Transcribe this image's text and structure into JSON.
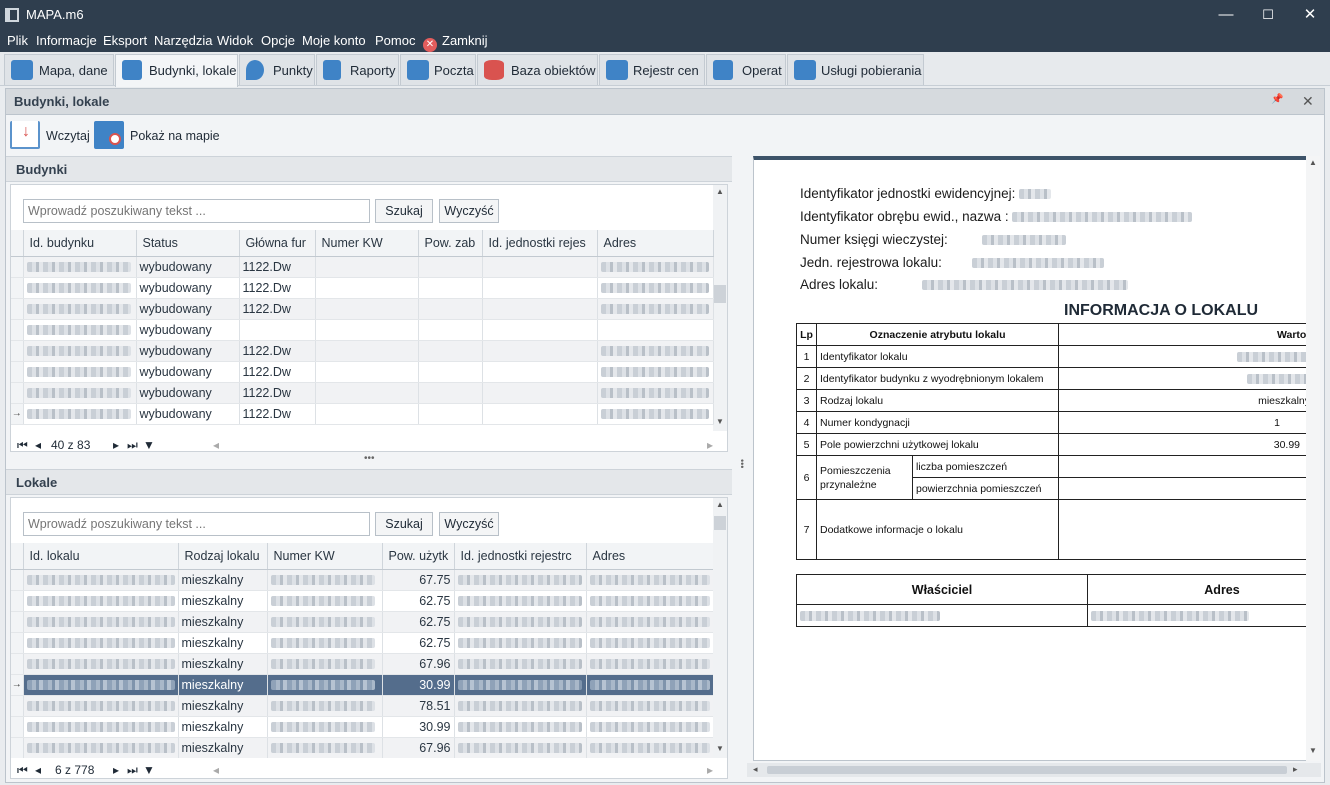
{
  "window": {
    "title": "MAPA.m6",
    "min": "—",
    "max": "☐",
    "close": "✕"
  },
  "menu": [
    "Plik",
    "Informacje",
    "Eksport",
    "Narzędzia",
    "Widok",
    "Opcje",
    "Moje konto",
    "Pomoc",
    "Zamknij"
  ],
  "tabs": [
    "Mapa, dane",
    "Budynki, lokale",
    "Punkty",
    "Raporty",
    "Poczta",
    "Baza obiektów",
    "Rejestr cen",
    "Operat",
    "Usługi pobierania"
  ],
  "active_tab": "Budynki, lokale",
  "panel": {
    "title": "Budynki, lokale",
    "pin": "📌",
    "close": "✕"
  },
  "toolbar": {
    "load": "Wczytaj",
    "show_map": "Pokaż na mapie"
  },
  "buildings": {
    "header": "Budynki",
    "search_placeholder": "Wprowadź poszukiwany tekst ...",
    "search_btn": "Szukaj",
    "clear_btn": "Wyczyść",
    "columns": [
      "Id. budynku",
      "Status",
      "Główna fur",
      "Numer KW",
      "Pow. zab",
      "Id. jednostki rejes",
      "Adres"
    ],
    "rows": [
      {
        "status": "wybudowany",
        "func": "1122.Dw"
      },
      {
        "status": "wybudowany",
        "func": "1122.Dw"
      },
      {
        "status": "wybudowany",
        "func": "1122.Dw"
      },
      {
        "status": "wybudowany",
        "func": ""
      },
      {
        "status": "wybudowany",
        "func": "1122.Dw"
      },
      {
        "status": "wybudowany",
        "func": "1122.Dw"
      },
      {
        "status": "wybudowany",
        "func": "1122.Dw"
      },
      {
        "status": "wybudowany",
        "func": "1122.Dw"
      }
    ],
    "pager": "40 z 83"
  },
  "locals": {
    "header": "Lokale",
    "search_placeholder": "Wprowadź poszukiwany tekst ...",
    "search_btn": "Szukaj",
    "clear_btn": "Wyczyść",
    "columns": [
      "Id. lokalu",
      "Rodzaj lokalu",
      "Numer KW",
      "Pow. użytk",
      "Id. jednostki rejestrc",
      "Adres"
    ],
    "rows": [
      {
        "type": "mieszkalny",
        "area": "67.75"
      },
      {
        "type": "mieszkalny",
        "area": "62.75"
      },
      {
        "type": "mieszkalny",
        "area": "62.75"
      },
      {
        "type": "mieszkalny",
        "area": "62.75"
      },
      {
        "type": "mieszkalny",
        "area": "67.96"
      },
      {
        "type": "mieszkalny",
        "area": "30.99"
      },
      {
        "type": "mieszkalny",
        "area": "78.51"
      },
      {
        "type": "mieszkalny",
        "area": "30.99"
      },
      {
        "type": "mieszkalny",
        "area": "67.96"
      }
    ],
    "pager": "6 z 778"
  },
  "report": {
    "labels": [
      "Identyfikator jednostki ewidencyjnej:",
      "Identyfikator obrębu ewid., nazwa :",
      "Numer księgi wieczystej:",
      "Jedn. rejestrowa lokalu:",
      "Adres lokalu:"
    ],
    "title": "INFORMACJA O LOKALU",
    "col_lp": "Lp",
    "col_attr": "Oznaczenie atrybutu lokalu",
    "col_value": "Wartość",
    "rows": {
      "r1": {
        "lp": "1",
        "attr": "Identyfikator lokalu"
      },
      "r2": {
        "lp": "2",
        "attr": "Identyfikator budynku z wyodrębnionym lokalem"
      },
      "r3": {
        "lp": "3",
        "attr": "Rodzaj lokalu",
        "val": "mieszkalny"
      },
      "r4": {
        "lp": "4",
        "attr": "Numer kondygnacji",
        "val": "1"
      },
      "r5": {
        "lp": "5",
        "attr": "Pole powierzchni użytkowej lokalu",
        "val": "30.99"
      },
      "r6": {
        "lp": "6",
        "attr": "Pomieszczenia przynależne",
        "sub1": "liczba pomieszczeń",
        "sub2": "powierzchnia pomieszczeń"
      },
      "r7": {
        "lp": "7",
        "attr": "Dodatkowe informacje o lokalu"
      }
    },
    "owner_col": "Właściciel",
    "address_col": "Adres"
  },
  "colors": {
    "titlebar": "#2f3e4e",
    "accent": "#3f83c6",
    "selection": "#546d8c"
  }
}
